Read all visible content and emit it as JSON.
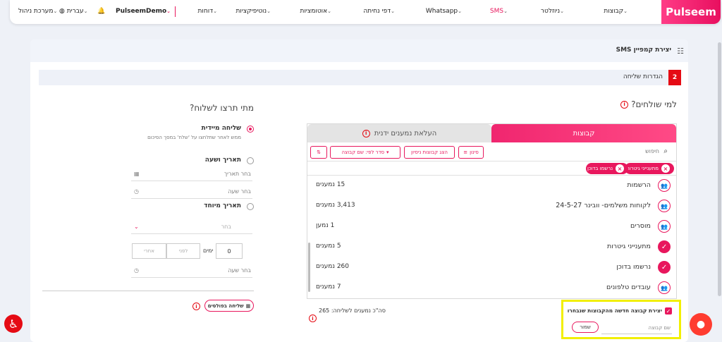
{
  "brand": {
    "logo": "Pulseem",
    "accent": "#e8175d"
  },
  "nav": {
    "items": [
      {
        "label": "קבוצות"
      },
      {
        "label": "ניוזלטר"
      },
      {
        "label": "SMS"
      },
      {
        "label": "Whatsapp"
      },
      {
        "label": "דפי נחיתה"
      },
      {
        "label": "אוטומציות"
      },
      {
        "label": "נוטיפיקציות"
      },
      {
        "label": "דוחות"
      }
    ],
    "account": "PulseemDemo",
    "language": "עברית",
    "admin": "מערכת ניהול"
  },
  "page": {
    "title": "יצירת קמפיין SMS",
    "step_number": "2",
    "step_title": "הגדרות שליחה"
  },
  "recipients": {
    "heading": "למי שולחים?",
    "tab_groups": "קבוצות",
    "tab_manual": "העלאת נמענים ידנית",
    "search_placeholder": "חיפוש",
    "filter_label": "סינון",
    "show_test_groups_label": "הצג קבוצות ניסיון",
    "sort_label": "סדר לפי: שם קבוצה",
    "chips": [
      "מתענייני גיטרות",
      "נרשמו בדוכן"
    ],
    "groups": [
      {
        "name": "הרשמות",
        "count": "15 נמענים",
        "selected": false
      },
      {
        "name": "לקוחות משלמים- וובינר 24-5-27",
        "count": "3,413 נמענים",
        "selected": false
      },
      {
        "name": "מוסרים",
        "count": "1 נמען",
        "selected": false
      },
      {
        "name": "מתענייני גיטרות",
        "count": "5 נמענים",
        "selected": true
      },
      {
        "name": "נרשמו בדוכן",
        "count": "260 נמענים",
        "selected": true
      },
      {
        "name": "עובדים טלפונים",
        "count": "7 נמענים",
        "selected": false
      }
    ],
    "new_group_checkbox_label": "יצירת קבוצה חדשה מהקבוצות שנבחרו",
    "new_group_name_placeholder": "שם קבוצה",
    "save_label": "שמור",
    "total_label": "סה\"כ נמענים לשליחה: 265"
  },
  "schedule": {
    "heading": "מתי תרצו לשלוח?",
    "immediate_label": "שליחה מיידית",
    "immediate_desc": "ממש לאחר שתלחצו על 'שלח' במסך הסיכום",
    "datetime_label": "תאריך ושעה",
    "date_placeholder": "בחר תאריך",
    "time_placeholder": "בחר שעה",
    "special_label": "תאריך מיוחד",
    "select_placeholder": "בחר",
    "days_value": "0",
    "days_label": "ימים",
    "before_label": "לפני",
    "after_label": "אחרי",
    "time2_placeholder": "בחר שעה",
    "batch_label": "שליחה בפולסים"
  }
}
